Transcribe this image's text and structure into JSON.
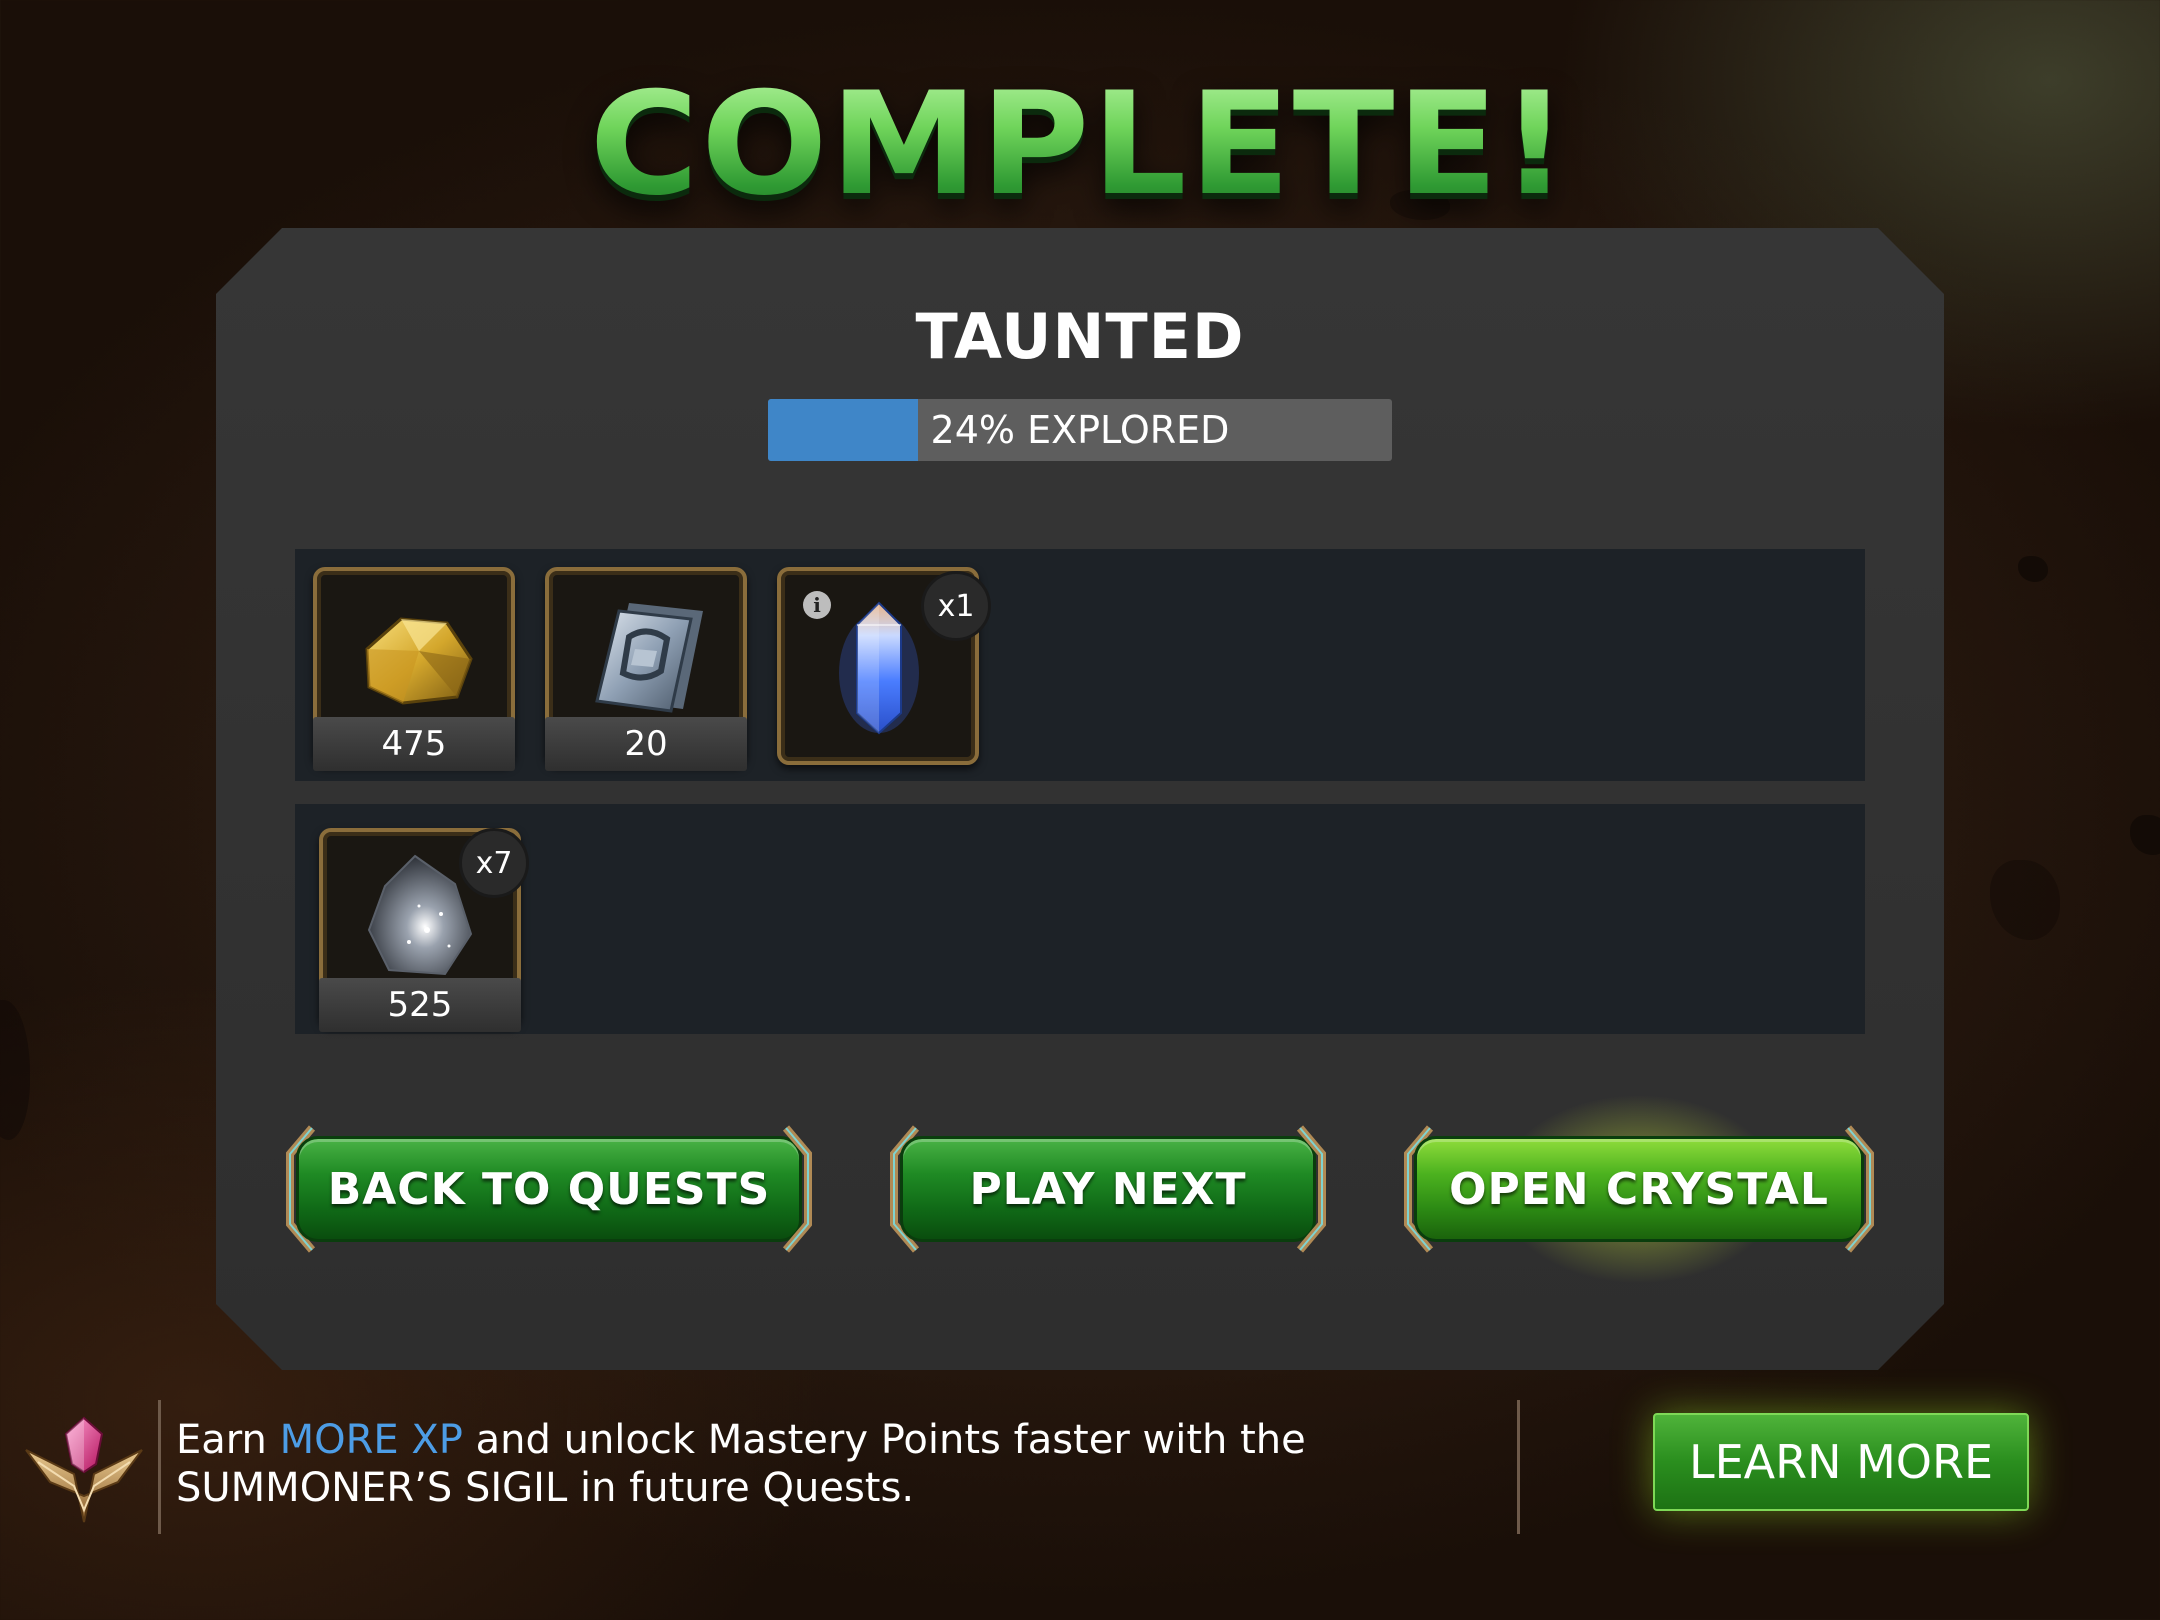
{
  "header": {
    "title": "COMPLETE!"
  },
  "quest": {
    "name": "TAUNTED",
    "progress_label": "24% EXPLORED",
    "progress_fraction": 0.24,
    "progress_color": "#3f86c8"
  },
  "rewards_row1": [
    {
      "name": "gold-icon",
      "amount": "475"
    },
    {
      "name": "battlechip-icon",
      "amount": "20"
    },
    {
      "name": "crystal-icon",
      "count": "x1",
      "info": "i"
    }
  ],
  "rewards_row2": [
    {
      "name": "shard-icon",
      "count": "x7",
      "amount": "525"
    }
  ],
  "buttons": {
    "back": "BACK TO QUESTS",
    "next": "PLAY NEXT",
    "open": "OPEN CRYSTAL"
  },
  "footer": {
    "text_before": "Earn ",
    "highlight": "MORE XP",
    "text_after": " and unlock Mastery Points faster with the",
    "line2": "SUMMONER’S SIGIL in future Quests.",
    "learn_more": "LEARN MORE",
    "highlight_color": "#4d9de6"
  }
}
